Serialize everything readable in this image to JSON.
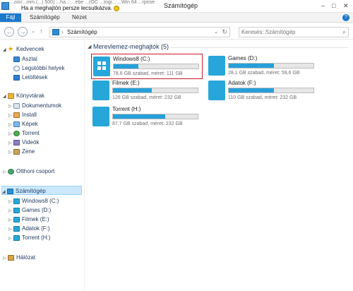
{
  "titlebar": {
    "overlay_top": "...o/o/...mm.(...) 500) ...ha... ...ebe ...(OC ...)ogi... ...Win 64 ...rprise",
    "overlay_text": "Ha a meghajtón  persze lecsutkázva.",
    "title": "Számítógép",
    "minimize": "–",
    "maximize": "□",
    "close": "✕"
  },
  "ribbon": {
    "tabs": [
      "Fájl",
      "Számítógép",
      "Nézet"
    ],
    "help": "?"
  },
  "address": {
    "back": "←",
    "forward": "→",
    "history": "⌄",
    "up": "↑",
    "separator": "›",
    "path": "Számítógép",
    "dropdown": "⌄",
    "refresh": "↻",
    "search_placeholder": "Keresés: Számítógép",
    "search_icon": "⌕"
  },
  "nav": {
    "favorites": {
      "label": "Kedvencek",
      "items": [
        "Asztal",
        "Legutóbbi helyek",
        "Letöltések"
      ]
    },
    "libraries": {
      "label": "Könyvtárak",
      "items": [
        "Dokumentumok",
        "Install",
        "Képek",
        "Torrent",
        "Videók",
        "Zene"
      ]
    },
    "homegroup": {
      "label": "Otthoni csoport"
    },
    "computer": {
      "label": "Számítógép",
      "items": [
        "Windows8 (C:)",
        "Games (D:)",
        "Filmek (E:)",
        "Adatok (F:)",
        "Torrent (H:)"
      ]
    },
    "network": {
      "label": "Hálózat"
    }
  },
  "content": {
    "group_label": "Merevlemez-meghajtók (5)",
    "drives": [
      {
        "name": "Windows8 (C:)",
        "info": "78,6 GB szabad, méret: 111 GB",
        "used_fraction": 0.29,
        "icon": "windows-drive-icon"
      },
      {
        "name": "Games (D:)",
        "info": "28,1 GB szabad, méret: 59,6 GB",
        "used_fraction": 0.53,
        "icon": "drive-icon"
      },
      {
        "name": "Filmek (E:)",
        "info": "126 GB szabad, méret: 232 GB",
        "used_fraction": 0.46,
        "icon": "drive-icon"
      },
      {
        "name": "Adatok (F:)",
        "info": "110 GB szabad, méret: 232 GB",
        "used_fraction": 0.53,
        "icon": "drive-icon"
      },
      {
        "name": "Torrent (H:)",
        "info": "87,7 GB szabad, méret: 232 GB",
        "used_fraction": 0.62,
        "icon": "drive-icon"
      }
    ]
  },
  "colors": {
    "accent": "#1979ca",
    "bar_fill": "#26a0da",
    "selection": "#cce8ff",
    "selected_tile_border": "#c8192a"
  }
}
